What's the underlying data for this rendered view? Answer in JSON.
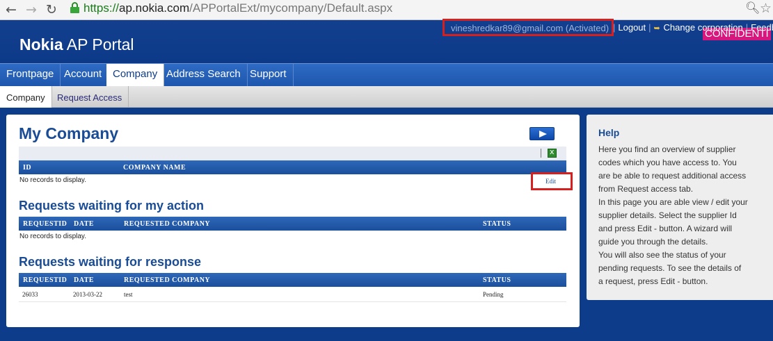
{
  "browser": {
    "back_icon": "back-arrow-icon",
    "forward_icon": "forward-arrow-icon",
    "reload_icon": "reload-icon",
    "url_secure": "https://",
    "url_host": "ap.nokia.com",
    "url_path": "/APPortalExt/mycompany/Default.aspx"
  },
  "header": {
    "logo_bold": "Nokia",
    "logo_rest": " AP Portal",
    "confidential": "CONFIDENTI",
    "user": "vineshredkar89@gmail.com (Activated)",
    "logout": "Logout",
    "change_corporation": "Change corporation",
    "feedback": "Feedb"
  },
  "main_nav": {
    "items": [
      {
        "label": "Frontpage"
      },
      {
        "label": "Account"
      },
      {
        "label": "Company"
      },
      {
        "label": "Address Search"
      },
      {
        "label": "Support"
      }
    ],
    "active": "Company"
  },
  "sub_nav": {
    "items": [
      {
        "label": "Company"
      },
      {
        "label": "Request Access"
      }
    ],
    "active": "Company"
  },
  "content": {
    "title": "My Company",
    "company_table": {
      "headers": [
        "ID",
        "COMPANY NAME"
      ],
      "empty_text": "No records to display."
    },
    "waiting_action": {
      "title": "Requests waiting for my action",
      "headers": [
        "REQUESTID",
        "DATE",
        "REQUESTED COMPANY",
        "STATUS"
      ],
      "empty_text": "No records to display."
    },
    "waiting_response": {
      "title": "Requests waiting for response",
      "headers": [
        "REQUESTID",
        "DATE",
        "REQUESTED COMPANY",
        "STATUS"
      ],
      "rows": [
        {
          "requestid": "26033",
          "date": "2013-03-22",
          "company": "test",
          "status": "Pending",
          "action": "Edit"
        }
      ]
    }
  },
  "help": {
    "title": "Help",
    "lines": [
      "Here you find an overview of supplier",
      "codes which you have access to. You",
      "are be able to request additional access",
      "from Request access tab.",
      "In this page you are able view / edit your",
      "supplier details. Select the supplier Id",
      "and press Edit - button. A wizard will",
      "guide you through the details.",
      "You will also see the status of your",
      "pending requests. To see the details of",
      "a request, press Edit - button."
    ]
  },
  "colors": {
    "page_bg": "#0d3c8b",
    "heading": "#1a4c95",
    "highlight": "#d62020",
    "confidential": "#d9157e"
  }
}
